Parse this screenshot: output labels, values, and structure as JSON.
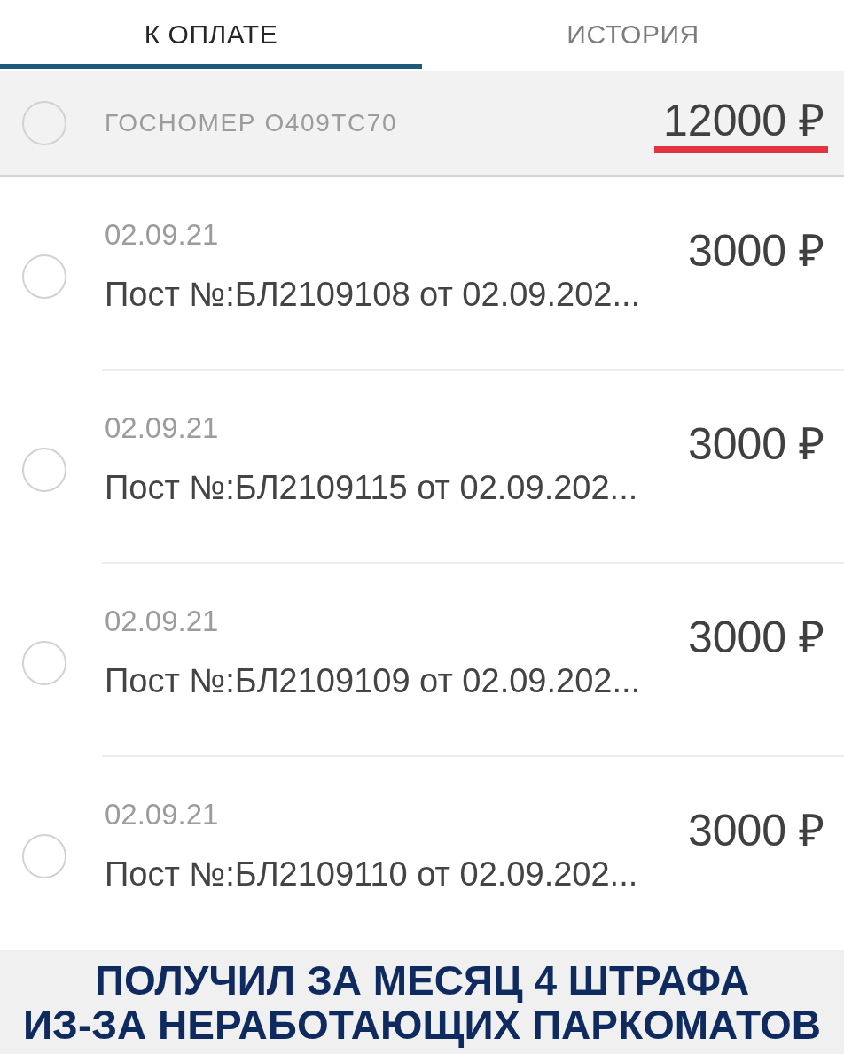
{
  "tabs": [
    {
      "label": "К ОПЛАТЕ",
      "selected": true
    },
    {
      "label": "ИСТОРИЯ",
      "selected": false
    }
  ],
  "group": {
    "title": "ГОСНОМЕР О409ТС70",
    "amount": "12000 ₽",
    "checked": false,
    "amount_underlined": true
  },
  "fines": [
    {
      "date": "02.09.21",
      "description": "Пост №:БЛ2109108 от 02.09.202...",
      "amount": "3000 ₽",
      "checked": false
    },
    {
      "date": "02.09.21",
      "description": "Пост №:БЛ2109115 от 02.09.202...",
      "amount": "3000 ₽",
      "checked": false
    },
    {
      "date": "02.09.21",
      "description": "Пост №:БЛ2109109 от 02.09.202...",
      "amount": "3000 ₽",
      "checked": false
    },
    {
      "date": "02.09.21",
      "description": "Пост №:БЛ2109110 от 02.09.202...",
      "amount": "3000 ₽",
      "checked": false
    }
  ],
  "caption": {
    "lines": [
      "ПОЛУЧИЛ ЗА МЕСЯЦ 4 ШТРАФА",
      "ИЗ-ЗА НЕРАБОТАЮЩИХ ПАРКОМАТОВ"
    ]
  }
}
